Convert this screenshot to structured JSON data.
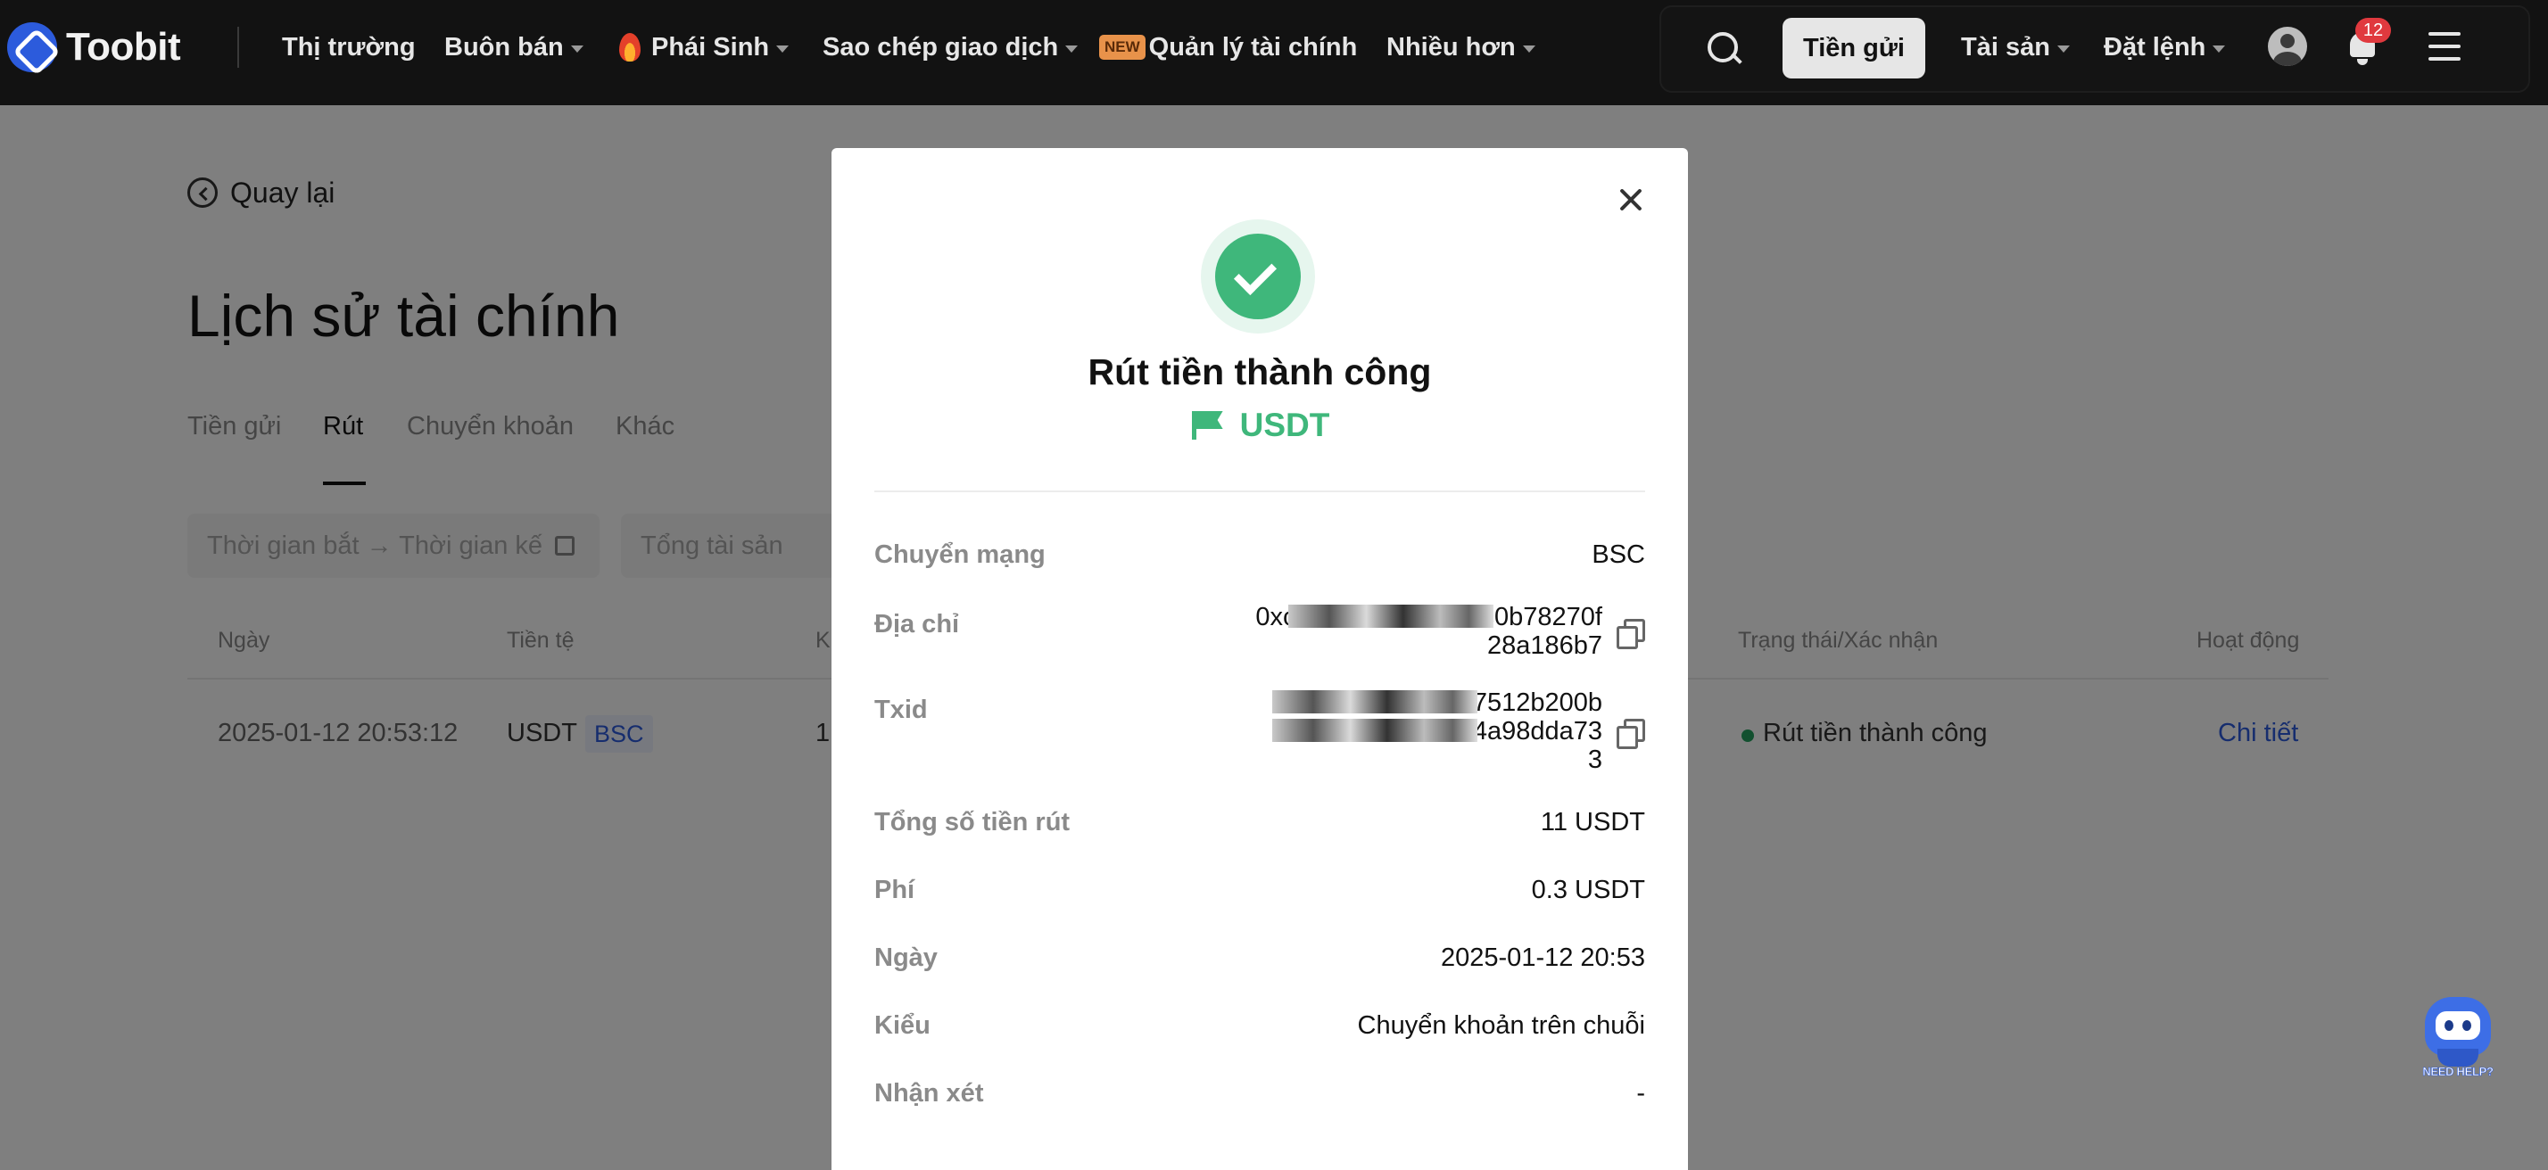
{
  "brand": {
    "name": "Toobit"
  },
  "nav": {
    "market": "Thị trường",
    "trade": "Buôn bán",
    "derivatives": "Phái Sinh",
    "copy_trading": "Sao chép giao dịch",
    "new_badge": "NEW",
    "wealth": "Quản lý tài chính",
    "more": "Nhiều hơn"
  },
  "header_right": {
    "deposit": "Tiền gửi",
    "assets": "Tài sản",
    "orders": "Đặt lệnh",
    "notification_count": "12"
  },
  "page": {
    "back": "Quay lại",
    "title": "Lịch sử tài chính",
    "tabs": [
      {
        "label": "Tiền gửi"
      },
      {
        "label": "Rút"
      },
      {
        "label": "Chuyển khoản"
      },
      {
        "label": "Khác"
      }
    ],
    "filters": {
      "date_range": "Thời gian bắt → Thời gian kết",
      "total_assets": "Tổng tài sản"
    },
    "table": {
      "columns": {
        "date": "Ngày",
        "currency": "Tiền tệ",
        "amount_partial": "K",
        "status": "Trạng thái/Xác nhận",
        "action": "Hoạt động"
      },
      "rows": [
        {
          "date": "2025-01-12 20:53:12",
          "currency": "USDT",
          "chain": "BSC",
          "amount_partial": "1",
          "status": "Rút tiền thành công",
          "action": "Chi tiết"
        }
      ]
    }
  },
  "modal": {
    "title": "Rút tiền thành công",
    "coin": "USDT",
    "fields": [
      {
        "label": "Chuyển mạng",
        "value": "BSC"
      },
      {
        "label": "Địa chỉ",
        "value_line1": "0xc8ae6ce0                    5d6f25c0b78270f",
        "value_line2": "28a186b7"
      },
      {
        "label": "Txid",
        "value_line1": "0xfa7e                          027512b200b",
        "value_line2": "c0682d                          4a98dda73",
        "value_line3": "3"
      },
      {
        "label": "Tổng số tiền rút",
        "value": "11 USDT"
      },
      {
        "label": "Phí",
        "value": "0.3 USDT"
      },
      {
        "label": "Ngày",
        "value": "2025-01-12 20:53"
      },
      {
        "label": "Kiểu",
        "value": "Chuyển khoản trên chuỗi"
      },
      {
        "label": "Nhận xét",
        "value": "-"
      }
    ]
  },
  "help_bot": {
    "label": "NEED HELP?"
  }
}
